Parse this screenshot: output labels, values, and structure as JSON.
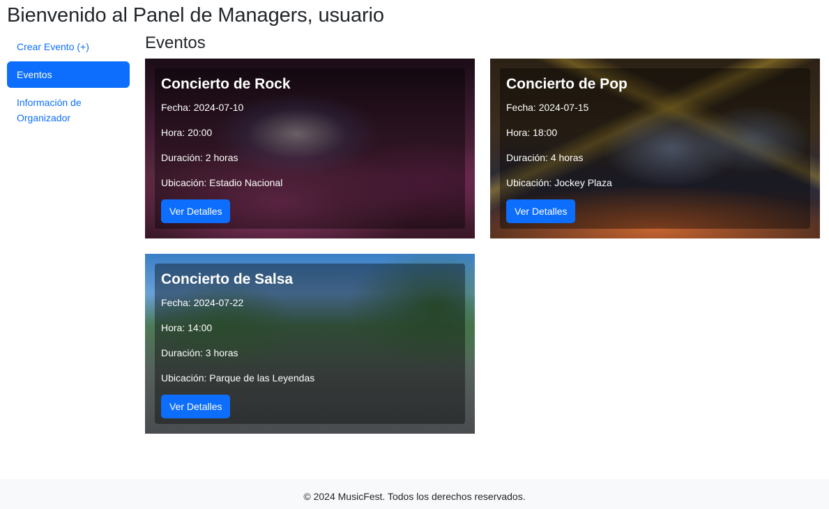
{
  "header": {
    "welcome": "Bienvenido al Panel de Managers, usuario"
  },
  "sidebar": {
    "items": [
      {
        "label": "Crear Evento (+)"
      },
      {
        "label": "Eventos"
      },
      {
        "label": "Información de Organizador"
      }
    ]
  },
  "main": {
    "title": "Eventos",
    "events": [
      {
        "title": "Concierto de Rock",
        "fecha": "Fecha: 2024-07-10",
        "hora": "Hora: 20:00",
        "duracion": "Duración: 2 horas",
        "ubicacion": "Ubicación: Estadio Nacional",
        "button": "Ver Detalles"
      },
      {
        "title": "Concierto de Pop",
        "fecha": "Fecha: 2024-07-15",
        "hora": "Hora: 18:00",
        "duracion": "Duración: 4 horas",
        "ubicacion": "Ubicación: Jockey Plaza",
        "button": "Ver Detalles"
      },
      {
        "title": "Concierto de Salsa",
        "fecha": "Fecha: 2024-07-22",
        "hora": "Hora: 14:00",
        "duracion": "Duración: 3 horas",
        "ubicacion": "Ubicación: Parque de las Leyendas",
        "button": "Ver Detalles"
      }
    ]
  },
  "footer": {
    "text": "© 2024 MusicFest. Todos los derechos reservados."
  },
  "colors": {
    "accent": "#0d6efd",
    "footer_bg": "#f8f9fa",
    "text": "#212529"
  }
}
